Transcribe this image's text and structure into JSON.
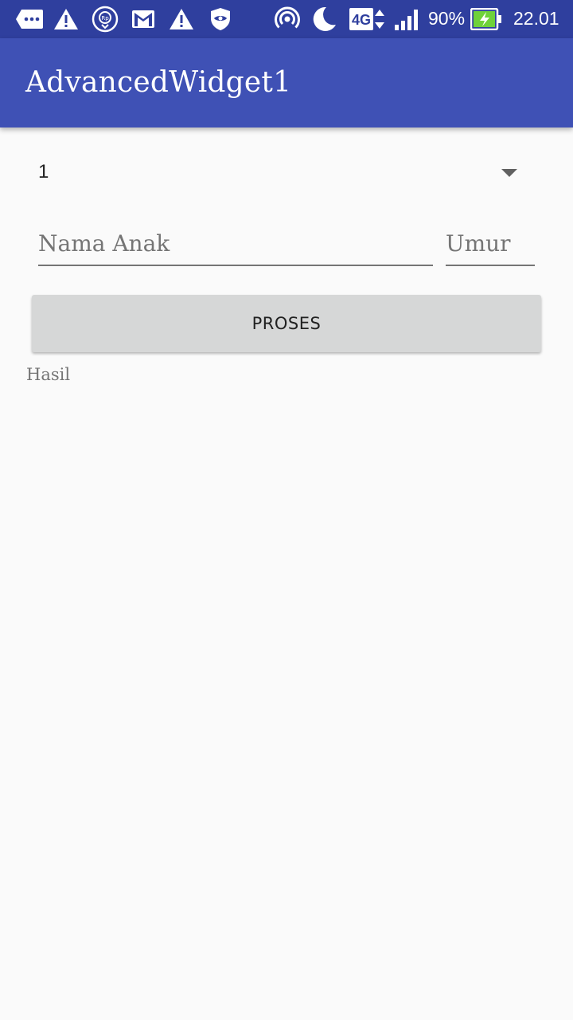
{
  "status_bar": {
    "battery": "90%",
    "time": "22.01",
    "network": "4G",
    "icons": [
      "chat-more-icon",
      "warning-icon",
      "rupiah-icon",
      "gmail-icon",
      "warning-icon",
      "shield-icon",
      "hotspot-icon",
      "moon-icon",
      "network-4g-icon",
      "signal-icon",
      "battery-charging-icon"
    ],
    "bg_color": "#2f3f9e"
  },
  "app_bar": {
    "title": "AdvancedWidget1",
    "bg_color": "#3f51b5"
  },
  "spinner": {
    "selected": "1"
  },
  "form": {
    "nama_placeholder": "Nama Anak",
    "umur_placeholder": "Umur"
  },
  "button": {
    "label": "PROSES"
  },
  "result": {
    "text": "Hasil"
  }
}
